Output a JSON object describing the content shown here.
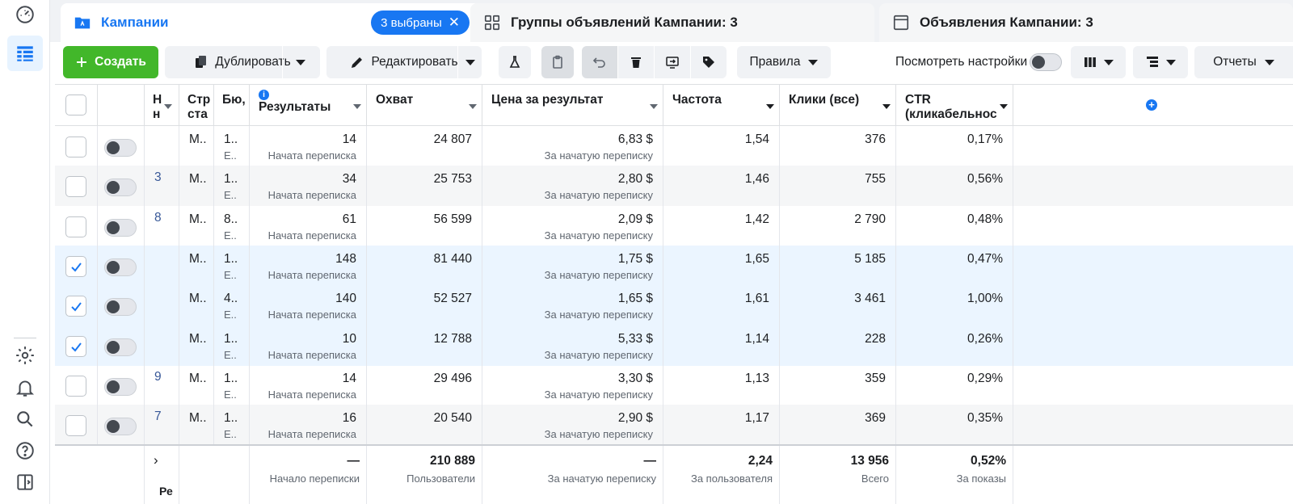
{
  "tabs": [
    {
      "label": "Кампании",
      "badge": "3 выбраны"
    },
    {
      "label": "Группы объявлений Кампании: 3"
    },
    {
      "label": "Объявления Кампании: 3"
    }
  ],
  "toolbar": {
    "create": "Создать",
    "duplicate": "Дублировать",
    "edit": "Редактировать",
    "rules": "Правила",
    "view_settings": "Посмотреть настройки",
    "reports": "Отчеты"
  },
  "columns": {
    "c1": "Н н",
    "c2": "Стр ста",
    "c3": "Бю,",
    "results": "Результаты",
    "reach": "Охват",
    "cost": "Цена за результат",
    "freq": "Частота",
    "clicks": "Клики (все)",
    "ctr": "CTR (кликабельнос"
  },
  "rows": [
    {
      "selected": false,
      "name": "",
      "status": "М..",
      "budget": "1..",
      "budget_sub": "Е..",
      "results": "14",
      "results_sub": "Начата переписка",
      "reach": "24 807",
      "cost": "6,83 $",
      "cost_sub": "За начатую переписку",
      "freq": "1,54",
      "clicks": "376",
      "ctr": "0,17%"
    },
    {
      "selected": false,
      "name": "3",
      "status": "М..",
      "budget": "1..",
      "budget_sub": "Е..",
      "results": "34",
      "results_sub": "Начата переписка",
      "reach": "25 753",
      "cost": "2,80 $",
      "cost_sub": "За начатую переписку",
      "freq": "1,46",
      "clicks": "755",
      "ctr": "0,56%"
    },
    {
      "selected": false,
      "name": "8",
      "status": "М..",
      "budget": "8..",
      "budget_sub": "Е..",
      "results": "61",
      "results_sub": "Начата переписка",
      "reach": "56 599",
      "cost": "2,09 $",
      "cost_sub": "За начатую переписку",
      "freq": "1,42",
      "clicks": "2 790",
      "ctr": "0,48%"
    },
    {
      "selected": true,
      "name": "",
      "status": "М..",
      "budget": "1..",
      "budget_sub": "Е..",
      "results": "148",
      "results_sub": "Начата переписка",
      "reach": "81 440",
      "cost": "1,75 $",
      "cost_sub": "За начатую переписку",
      "freq": "1,65",
      "clicks": "5 185",
      "ctr": "0,47%"
    },
    {
      "selected": true,
      "name": "",
      "status": "М..",
      "budget": "4..",
      "budget_sub": "Е..",
      "results": "140",
      "results_sub": "Начата переписка",
      "reach": "52 527",
      "cost": "1,65 $",
      "cost_sub": "За начатую переписку",
      "freq": "1,61",
      "clicks": "3 461",
      "ctr": "1,00%"
    },
    {
      "selected": true,
      "name": "",
      "status": "М..",
      "budget": "1..",
      "budget_sub": "Е..",
      "results": "10",
      "results_sub": "Начата переписка",
      "reach": "12 788",
      "cost": "5,33 $",
      "cost_sub": "За начатую переписку",
      "freq": "1,14",
      "clicks": "228",
      "ctr": "0,26%"
    },
    {
      "selected": false,
      "name": "9",
      "status": "М..",
      "budget": "1..",
      "budget_sub": "Е..",
      "results": "14",
      "results_sub": "Начата переписка",
      "reach": "29 496",
      "cost": "3,30 $",
      "cost_sub": "За начатую переписку",
      "freq": "1,13",
      "clicks": "359",
      "ctr": "0,29%"
    },
    {
      "selected": false,
      "name": "7",
      "status": "М..",
      "budget": "1..",
      "budget_sub": "Е..",
      "results": "16",
      "results_sub": "Начата переписка",
      "reach": "20 540",
      "cost": "2,90 $",
      "cost_sub": "За начатую переписку",
      "freq": "1,17",
      "clicks": "369",
      "ctr": "0,35%"
    }
  ],
  "footer": {
    "expand_label": "Ре",
    "results": "—",
    "results_sub": "Начало переписки",
    "reach": "210 889",
    "reach_sub": "Пользователи",
    "cost": "—",
    "cost_sub": "За начатую переписку",
    "freq": "2,24",
    "freq_sub": "За пользователя",
    "clicks": "13 956",
    "clicks_sub": "Всего",
    "ctr": "0,52%",
    "ctr_sub": "За показы"
  },
  "colors": {
    "accent": "#1877f2",
    "create": "#42b72a",
    "selected_row": "#ebf5ff"
  }
}
